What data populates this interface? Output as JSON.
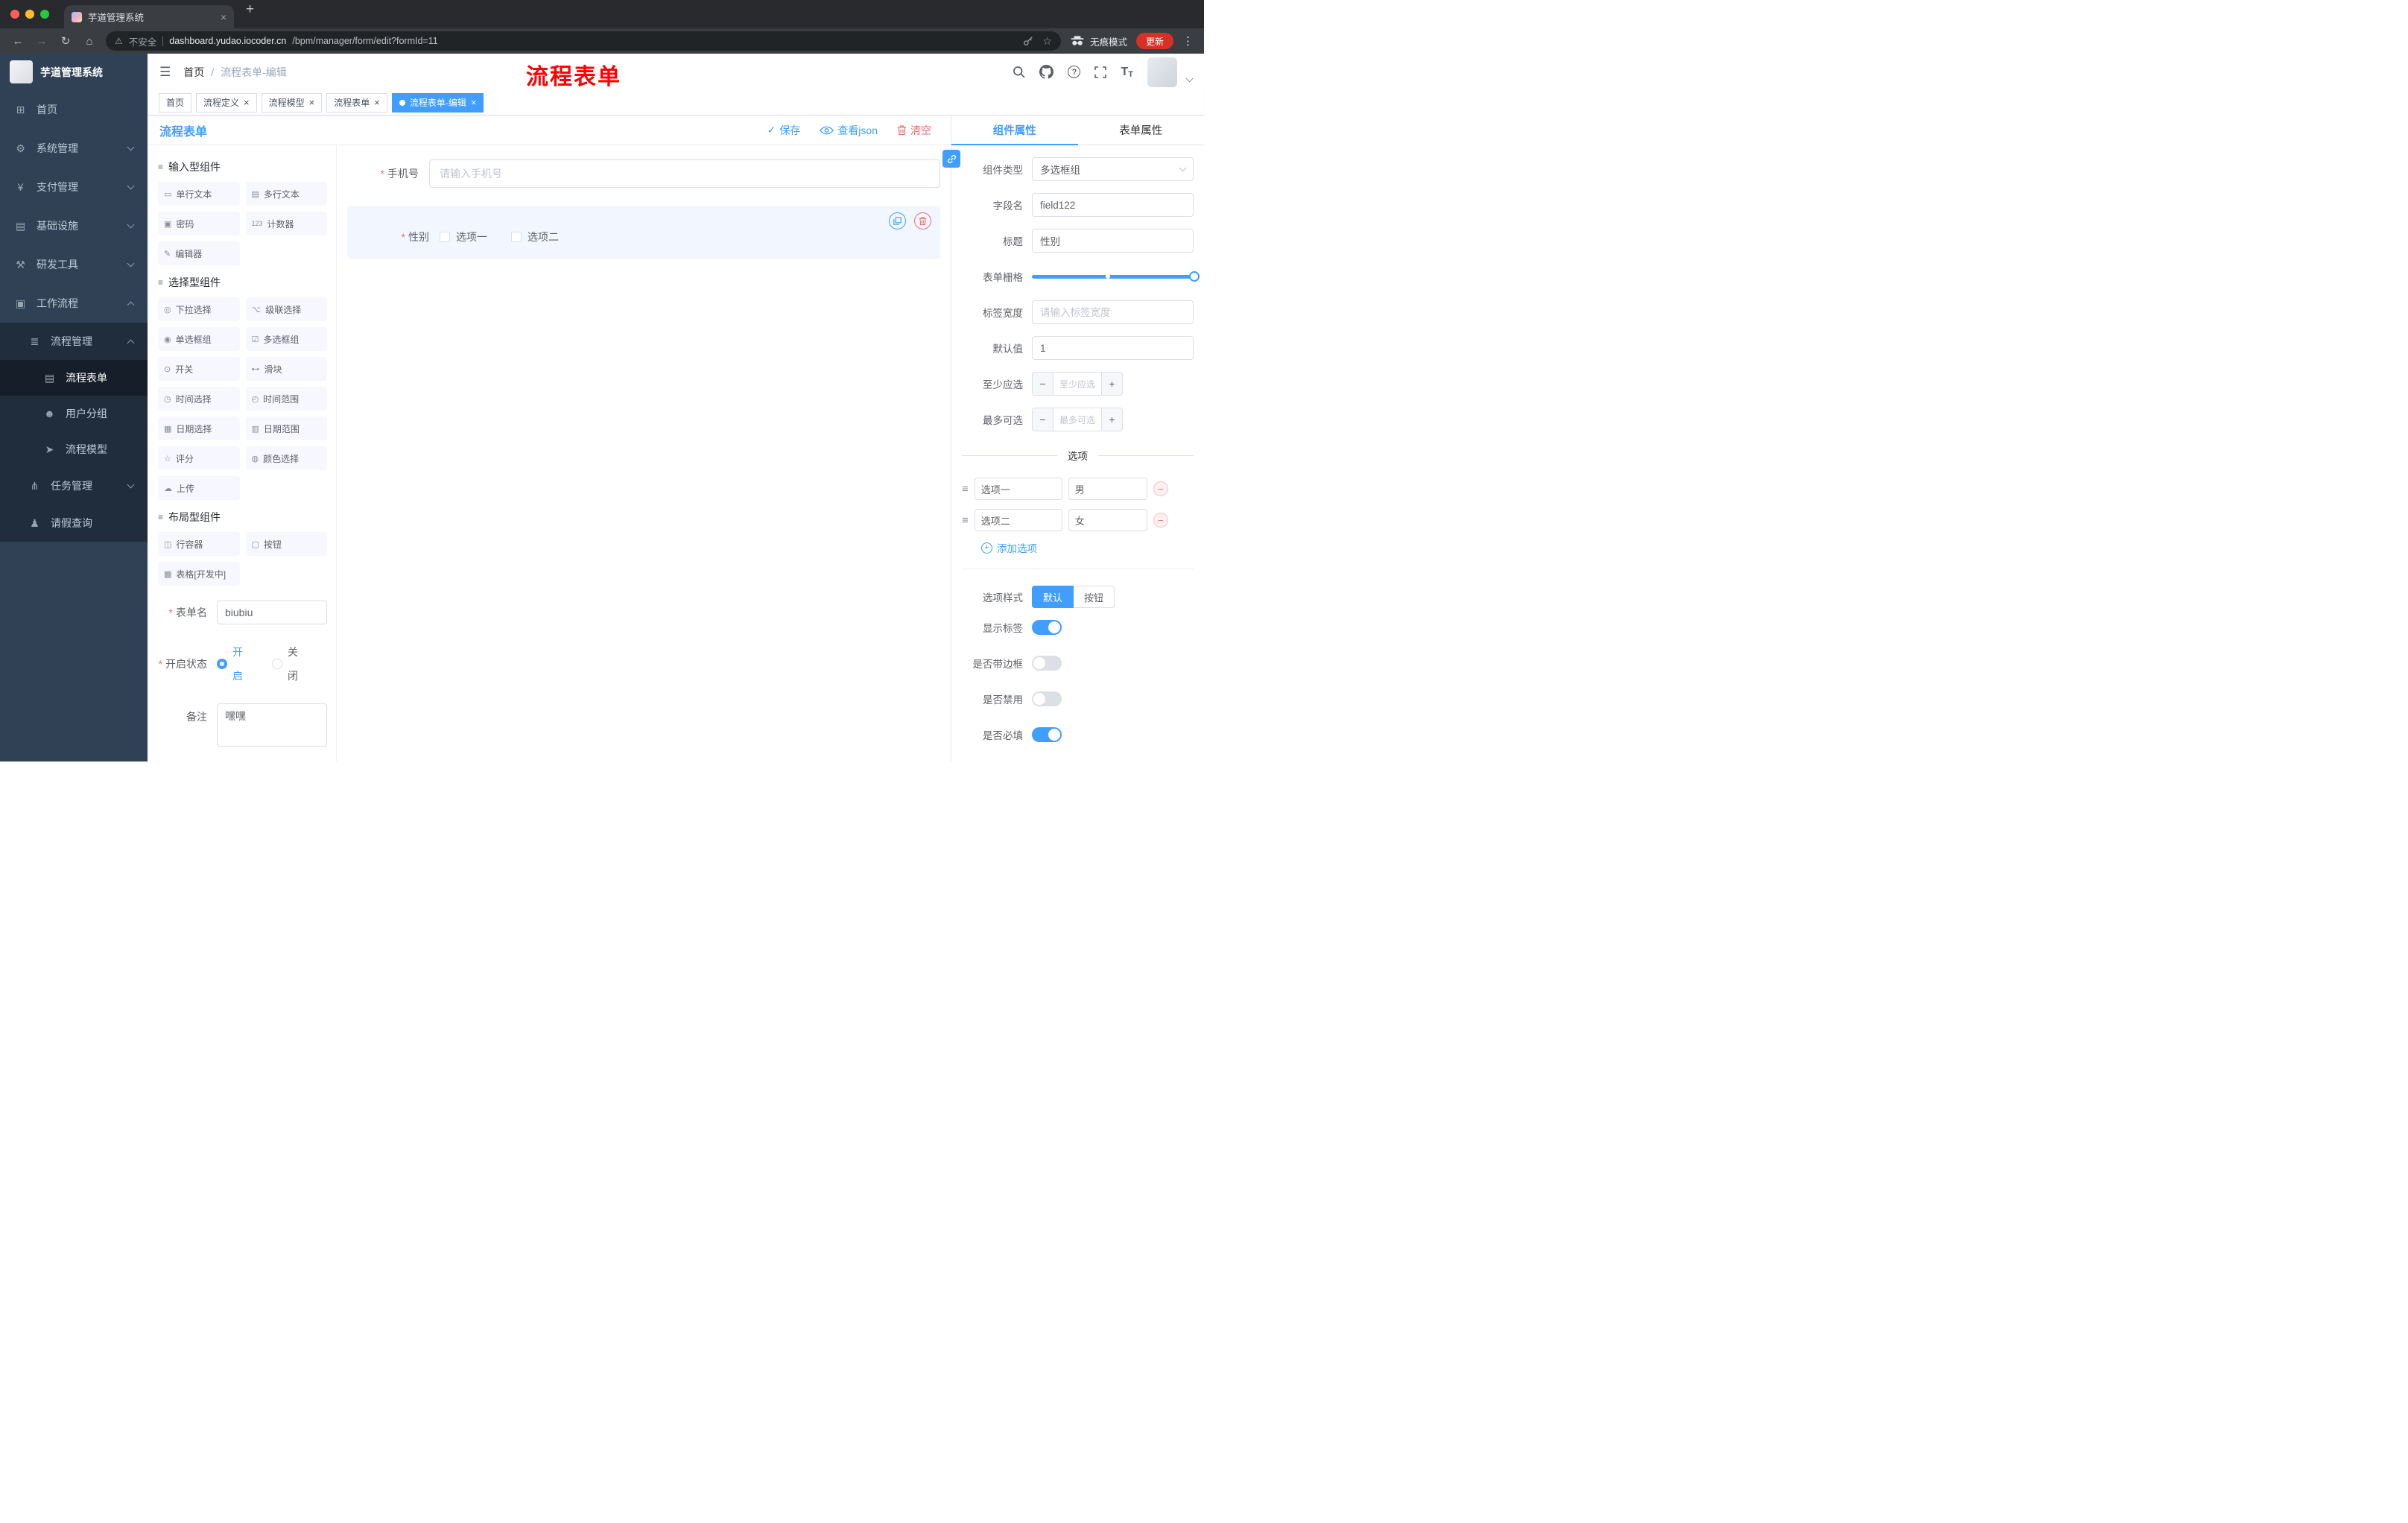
{
  "colors": {
    "primary": "#409eff",
    "danger": "#f56c6c",
    "annotation_red": "#fe0100",
    "sidebar_bg": "#304156",
    "sidebar_submenu_bg": "#1f2d3d",
    "tag_active_bg": "#409eff",
    "selected_widget_bg": "#f2f6fe"
  },
  "icons": {
    "back": "←",
    "forward": "→",
    "reload": "↻",
    "home": "⌂",
    "warning": "⚠",
    "star": "☆",
    "dots": "⋮",
    "close": "×",
    "plus_tab": "+",
    "hamburger": "☰",
    "question": "?",
    "font_size": "T",
    "check": "✓",
    "minus": "−",
    "plus": "+",
    "drag_handle": "≡"
  },
  "browser": {
    "tab_title": "芋道管理系统",
    "security_label": "不安全",
    "url_host": "dashboard.yudao.iocoder.cn",
    "url_path": "/bpm/manager/form/edit?formId=11",
    "incognito_label": "无痕模式",
    "update_label": "更新"
  },
  "sidebar": {
    "logo_title": "芋道管理系统",
    "items": [
      {
        "label": "首页",
        "icon": "⊞"
      },
      {
        "label": "系统管理",
        "icon": "⚙"
      },
      {
        "label": "支付管理",
        "icon": "¥"
      },
      {
        "label": "基础设施",
        "icon": "▤"
      },
      {
        "label": "研发工具",
        "icon": "⚒"
      },
      {
        "label": "工作流程",
        "icon": "▣"
      },
      {
        "label": "流程管理",
        "icon": "≣"
      },
      {
        "label": "流程表单",
        "icon": "▤"
      },
      {
        "label": "用户分组",
        "icon": "☻"
      },
      {
        "label": "流程模型",
        "icon": "➤"
      },
      {
        "label": "任务管理",
        "icon": "⋔"
      },
      {
        "label": "请假查询",
        "icon": "♟"
      }
    ]
  },
  "header": {
    "breadcrumb_home": "首页",
    "breadcrumb_sep": "/",
    "breadcrumb_current": "流程表单-编辑",
    "annotation": "流程表单"
  },
  "tags": {
    "items": [
      {
        "label": "首页"
      },
      {
        "label": "流程定义"
      },
      {
        "label": "流程模型"
      },
      {
        "label": "流程表单"
      },
      {
        "label": "流程表单-编辑"
      }
    ]
  },
  "designer": {
    "panel_title": "流程表单",
    "save_label": "保存",
    "view_json_label": "查看json",
    "clear_label": "清空",
    "palette": {
      "sections": [
        {
          "title": "输入型组件",
          "items": [
            {
              "label": "单行文本",
              "icon": "▭"
            },
            {
              "label": "多行文本",
              "icon": "▤"
            },
            {
              "label": "密码",
              "icon": "▣"
            },
            {
              "label": "计数器",
              "icon": "123"
            },
            {
              "label": "编辑器",
              "icon": "✎"
            }
          ]
        },
        {
          "title": "选择型组件",
          "items": [
            {
              "label": "下拉选择",
              "icon": "◎"
            },
            {
              "label": "级联选择",
              "icon": "⌥"
            },
            {
              "label": "单选框组",
              "icon": "◉"
            },
            {
              "label": "多选框组",
              "icon": "☑"
            },
            {
              "label": "开关",
              "icon": "⊙"
            },
            {
              "label": "滑块",
              "icon": "⊷"
            },
            {
              "label": "时间选择",
              "icon": "◷"
            },
            {
              "label": "时间范围",
              "icon": "◴"
            },
            {
              "label": "日期选择",
              "icon": "▦"
            },
            {
              "label": "日期范围",
              "icon": "▥"
            },
            {
              "label": "评分",
              "icon": "☆"
            },
            {
              "label": "颜色选择",
              "icon": "◍"
            },
            {
              "label": "上传",
              "icon": "☁"
            }
          ]
        },
        {
          "title": "布局型组件",
          "items": [
            {
              "label": "行容器",
              "icon": "◫"
            },
            {
              "label": "按钮",
              "icon": "▢"
            },
            {
              "label": "表格[开发中]",
              "icon": "▩"
            }
          ]
        }
      ]
    },
    "meta": {
      "form_name_label": "表单名",
      "form_name_value": "biubiu",
      "status_label": "开启状态",
      "status_on": "开启",
      "status_off": "关闭",
      "remark_label": "备注",
      "remark_value": "嘿嘿"
    },
    "canvas": {
      "phone_label": "手机号",
      "phone_placeholder": "请输入手机号",
      "gender_label": "性别",
      "gender_options": [
        {
          "label": "选项一"
        },
        {
          "label": "选项二"
        }
      ]
    }
  },
  "properties": {
    "tab_component": "组件属性",
    "tab_form": "表单属性",
    "component_type_label": "组件类型",
    "component_type_value": "多选框组",
    "field_name_label": "字段名",
    "field_name_value": "field122",
    "title_label": "标题",
    "title_value": "性别",
    "grid_label": "表单栅格",
    "label_width_label": "标签宽度",
    "label_width_placeholder": "请输入标签宽度",
    "default_label": "默认值",
    "default_value": "1",
    "min_label": "至少应选",
    "min_placeholder": "至少应选",
    "max_label": "最多可选",
    "max_placeholder": "最多可选",
    "options_title": "选项",
    "options": [
      {
        "name": "选项一",
        "value": "男"
      },
      {
        "name": "选项二",
        "value": "女"
      }
    ],
    "add_option_label": "添加选项",
    "option_style_label": "选项样式",
    "style_default": "默认",
    "style_button": "按钮",
    "show_tag_label": "显示标签",
    "border_label": "是否带边框",
    "disabled_label": "是否禁用",
    "required_label": "是否必填"
  }
}
